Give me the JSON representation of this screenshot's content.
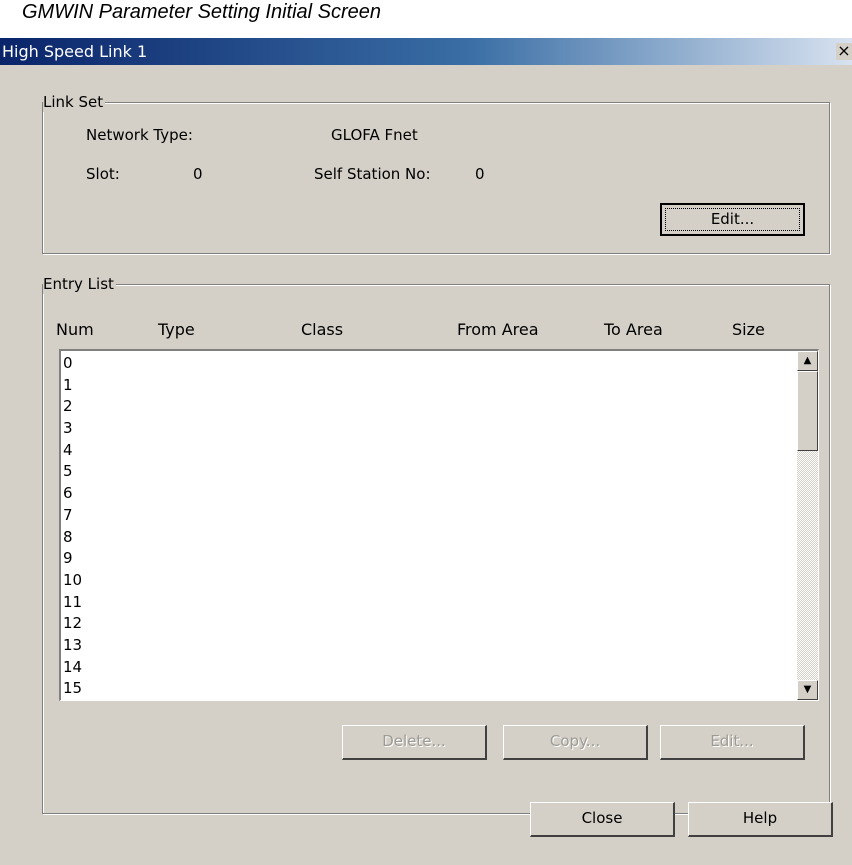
{
  "caption": "GMWIN Parameter Setting Initial Screen",
  "window": {
    "title": "High Speed Link 1",
    "close_glyph": "×"
  },
  "link_set": {
    "legend": "Link Set",
    "network_type_label": "Network Type:",
    "network_type_value": "GLOFA Fnet",
    "slot_label": "Slot:",
    "slot_value": "0",
    "self_station_label": "Self Station No:",
    "self_station_value": "0",
    "edit_label": "Edit..."
  },
  "entry_list": {
    "legend": "Entry List",
    "columns": [
      "Num",
      "Type",
      "Class",
      "From Area",
      "To Area",
      "Size"
    ],
    "rows": [
      "0",
      "1",
      "2",
      "3",
      "4",
      "5",
      "6",
      "7",
      "8",
      "9",
      "10",
      "11",
      "12",
      "13",
      "14",
      "15"
    ],
    "scroll_up_glyph": "▲",
    "scroll_down_glyph": "▼",
    "delete_label": "Delete...",
    "copy_label": "Copy...",
    "edit_label": "Edit..."
  },
  "footer": {
    "close_label": "Close",
    "help_label": "Help"
  }
}
